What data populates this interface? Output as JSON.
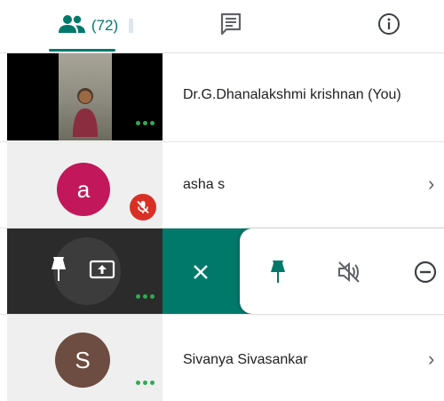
{
  "tabs": {
    "people": {
      "icon": "people-icon",
      "count_label": "(72)",
      "active": true
    },
    "chat": {
      "icon": "chat-icon"
    },
    "info": {
      "icon": "info-icon"
    }
  },
  "participants": [
    {
      "name": "Dr.G.Dhanalakshmi krishnan (You)",
      "tile": "video"
    },
    {
      "name": "asha s",
      "avatar_letter": "a",
      "avatar_color": "#c2185b",
      "mic_muted": true
    },
    {
      "name": "Sivanya Sivasankar",
      "avatar_letter": "S",
      "avatar_color": "#6d4c41"
    }
  ],
  "actions": {
    "close": {
      "icon": "close-icon"
    },
    "pin": {
      "icon": "pin-icon"
    },
    "mute": {
      "icon": "mute-icon"
    },
    "remove": {
      "icon": "remove-icon"
    },
    "tile_pin": {
      "icon": "pin-icon"
    },
    "tile_present": {
      "icon": "present-screen-icon"
    }
  },
  "colors": {
    "accent": "#00796b",
    "dots": "#34a853",
    "mic_off": "#d93025"
  }
}
